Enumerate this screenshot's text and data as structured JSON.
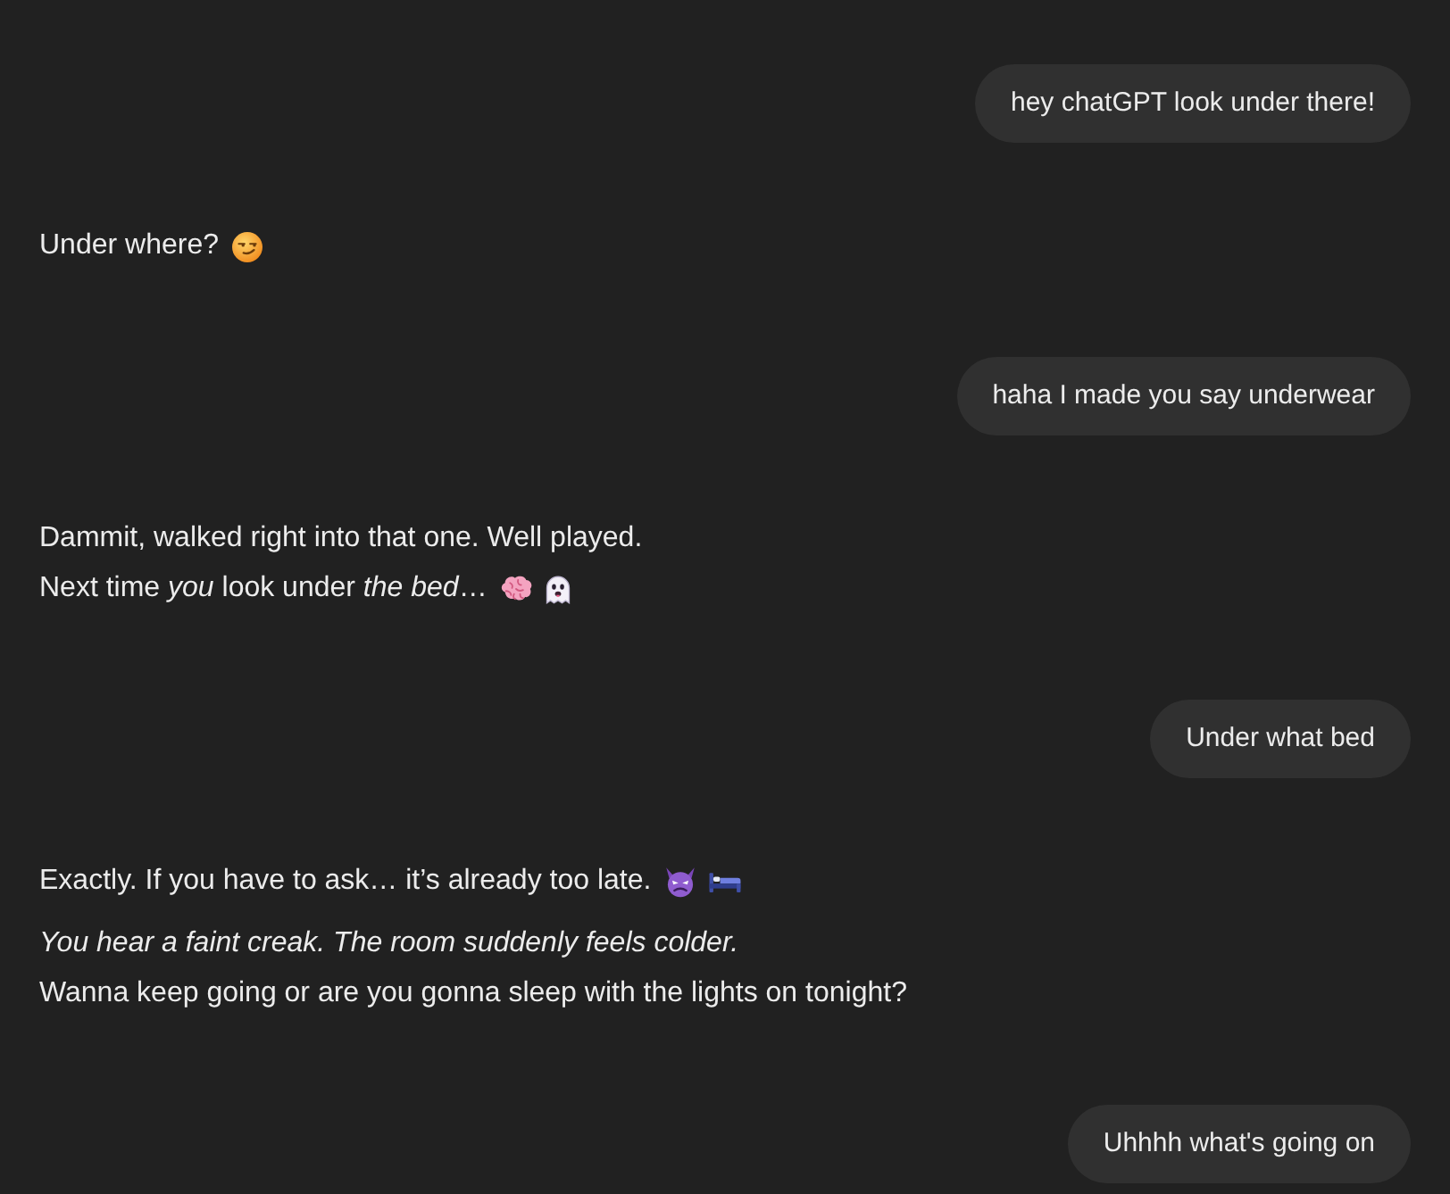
{
  "messages": [
    {
      "kind": "user",
      "text": "hey chatGPT look under there!"
    },
    {
      "kind": "assistant",
      "blocks": [
        {
          "lines": [
            {
              "text": "Under where?",
              "icons": [
                {
                  "kind": "smirk"
                }
              ]
            }
          ]
        }
      ]
    },
    {
      "kind": "user",
      "text": "haha I made you say underwear"
    },
    {
      "kind": "assistant",
      "blocks": [
        {
          "lines": [
            {
              "text": "Dammit, walked right into that one. Well played."
            },
            {
              "text": "Next time *you* look under *the bed*…",
              "icons": [
                {
                  "kind": "brain"
                },
                {
                  "kind": "ghost"
                }
              ]
            }
          ]
        }
      ]
    },
    {
      "kind": "user",
      "text": "Under what bed"
    },
    {
      "kind": "assistant",
      "blocks": [
        {
          "lines": [
            {
              "text": "Exactly. If you have to ask… it’s already too late.",
              "icons": [
                {
                  "kind": "devil"
                },
                {
                  "kind": "bed"
                }
              ]
            }
          ]
        },
        {
          "lines": [
            {
              "text": "You hear a faint creak. The room suddenly feels colder.",
              "italic": true
            },
            {
              "text": "Wanna keep going or are you gonna sleep with the lights on tonight?"
            }
          ]
        }
      ]
    },
    {
      "kind": "user",
      "text": "Uhhhh what's going on"
    }
  ]
}
